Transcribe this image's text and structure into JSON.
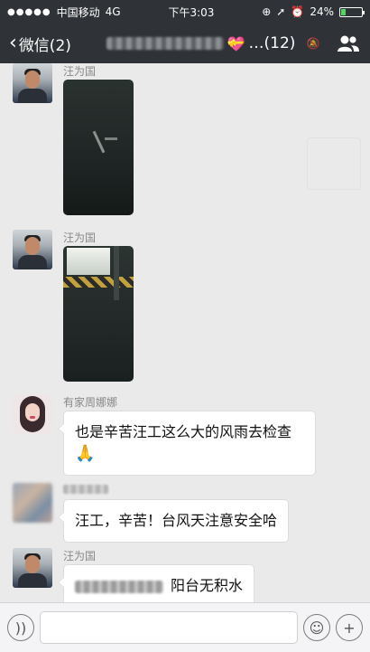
{
  "status": {
    "carrier": "中国移动",
    "network": "4G",
    "time": "下午3:03",
    "battery": "24%",
    "battery_level": 0.24
  },
  "nav": {
    "back_label": "微信(2)",
    "title_suffix": "…(12)"
  },
  "messages": [
    {
      "sender": "汪为国",
      "type": "image"
    },
    {
      "sender": "汪为国",
      "type": "image"
    },
    {
      "sender": "有家周娜娜",
      "type": "text",
      "text": "也是辛苦汪工这么大的风雨去检查",
      "emoji": "🙏"
    },
    {
      "sender": "",
      "type": "text",
      "text": "汪工，辛苦！台风天注意安全哈"
    },
    {
      "sender": "汪为国",
      "type": "text",
      "text": "阳台无积水"
    }
  ]
}
